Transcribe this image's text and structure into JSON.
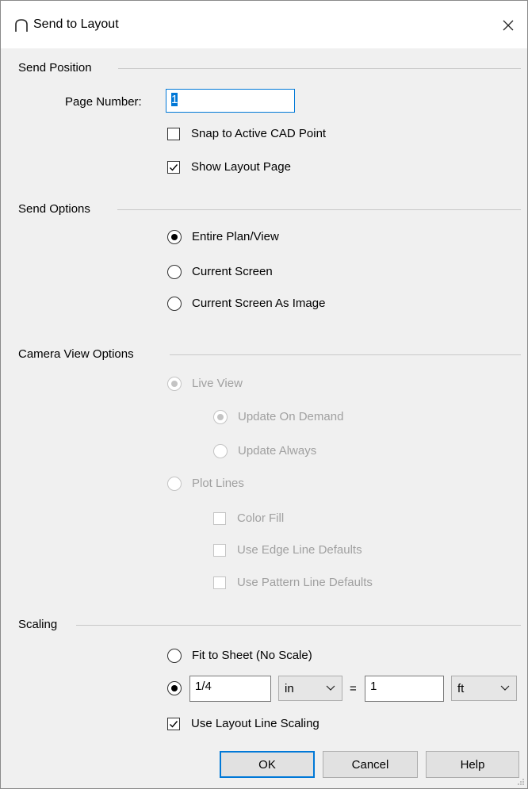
{
  "dialog": {
    "title": "Send to Layout"
  },
  "send_position": {
    "header": "Send Position",
    "page_number_label": "Page Number:",
    "page_number_value": "1",
    "snap_label": "Snap to Active CAD Point",
    "snap_checked": false,
    "show_layout_label": "Show Layout Page",
    "show_layout_checked": true
  },
  "send_options": {
    "header": "Send Options",
    "entire_plan": "Entire Plan/View",
    "current_screen": "Current Screen",
    "current_screen_image": "Current Screen As Image",
    "selected": "Entire Plan/View"
  },
  "camera_view": {
    "header": "Camera View Options",
    "live_view": "Live View",
    "update_on_demand": "Update On Demand",
    "update_always": "Update Always",
    "plot_lines": "Plot Lines",
    "color_fill": "Color Fill",
    "edge_line_defaults": "Use Edge Line Defaults",
    "pattern_line_defaults": "Use Pattern Line Defaults"
  },
  "scaling": {
    "header": "Scaling",
    "fit_to_sheet": "Fit to Sheet (No Scale)",
    "scale_left_value": "1/4",
    "scale_left_unit": "in",
    "equals": "=",
    "scale_right_value": "1",
    "scale_right_unit": "ft",
    "use_layout_line_scaling": "Use Layout Line Scaling",
    "use_layout_line_scaling_checked": true
  },
  "buttons": {
    "ok": "OK",
    "cancel": "Cancel",
    "help": "Help"
  },
  "colors": {
    "accent": "#0078d7",
    "dialog_bg": "#f0f0f0",
    "disabled_text": "#a0a0a0"
  }
}
